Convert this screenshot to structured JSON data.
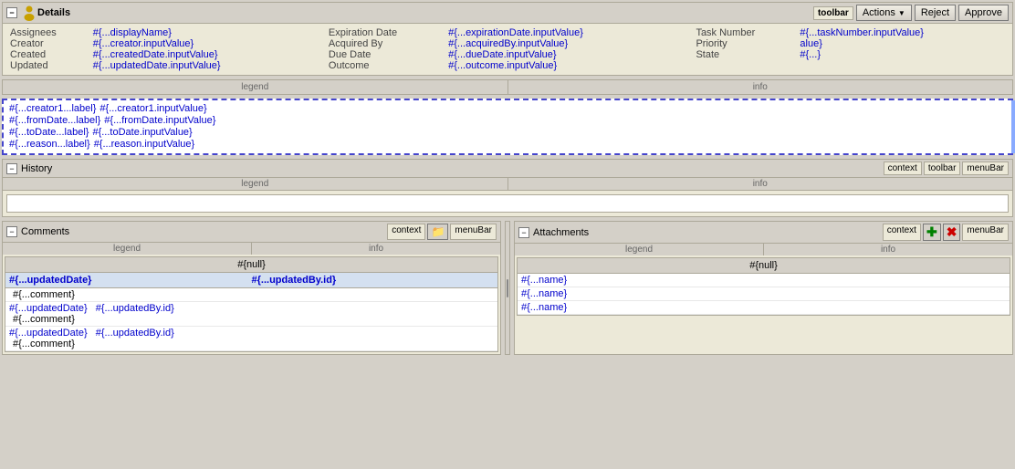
{
  "details": {
    "title": "Details",
    "collapse_label": "−",
    "toolbar_label": "toolbar",
    "actions_label": "Actions",
    "reject_label": "Reject",
    "approve_label": "Approve",
    "fields": {
      "assignees_label": "Assignees",
      "assignees_value": "#{...displayName}",
      "creator_label": "Creator",
      "creator_value": "#{...creator.inputValue}",
      "created_label": "Created",
      "created_value": "#{...createdDate.inputValue}",
      "updated_label": "Updated",
      "updated_value": "#{...updatedDate.inputValue}",
      "expiration_date_label": "Expiration Date",
      "expiration_date_value": "#{...expirationDate.inputValue}",
      "acquired_by_label": "Acquired By",
      "acquired_by_value": "#{...acquiredBy.inputValue}",
      "due_date_label": "Due Date",
      "due_date_value": "#{...dueDate.inputValue}",
      "outcome_label": "Outcome",
      "outcome_value": "#{...outcome.inputValue}",
      "task_number_label": "Task Number",
      "task_number_value": "#{...taskNumber.inputValue}",
      "priority_label": "Priority",
      "priority_value": "alue}",
      "state_label": "State",
      "state_value": "#{...}"
    }
  },
  "legend_bar": {
    "legend_label": "legend",
    "info_label": "info"
  },
  "middle_section": {
    "rows": [
      {
        "label": "#{...creator1...label}",
        "value": "#{...creator1.inputValue}"
      },
      {
        "label": "#{...fromDate...label}",
        "value": "#{...fromDate.inputValue}"
      },
      {
        "label": "#{...toDate...label}",
        "value": "#{...toDate.inputValue}"
      },
      {
        "label": "#{...reason...label}",
        "value": "#{...reason.inputValue}"
      }
    ]
  },
  "history": {
    "title": "History",
    "collapse_label": "−",
    "context_label": "context",
    "toolbar_label": "toolbar",
    "menubar_label": "menuBar",
    "legend_label": "legend",
    "info_label": "info"
  },
  "comments": {
    "title": "Comments",
    "collapse_label": "−",
    "context_label": "context",
    "menubar_label": "menuBar",
    "legend_label": "legend",
    "info_label": "info",
    "null_value": "#{null}",
    "table_header": {
      "updated_date": "#{...updatedDate}",
      "updated_by": "#{...updatedBy.id}"
    },
    "rows": [
      {
        "comment": "#{...comment}"
      },
      {
        "date": "#{...updatedDate}",
        "by": "#{...updatedBy.id}",
        "comment": "#{...comment}"
      },
      {
        "date": "#{...updatedDate}",
        "by": "#{...updatedBy.id}",
        "comment": "#{...comment}"
      }
    ]
  },
  "attachments": {
    "title": "Attachments",
    "collapse_label": "−",
    "context_label": "context",
    "menubar_label": "menuBar",
    "legend_label": "legend",
    "info_label": "info",
    "null_value": "#{null}",
    "names": [
      "#{...name}",
      "#{...name}",
      "#{...name}"
    ]
  }
}
